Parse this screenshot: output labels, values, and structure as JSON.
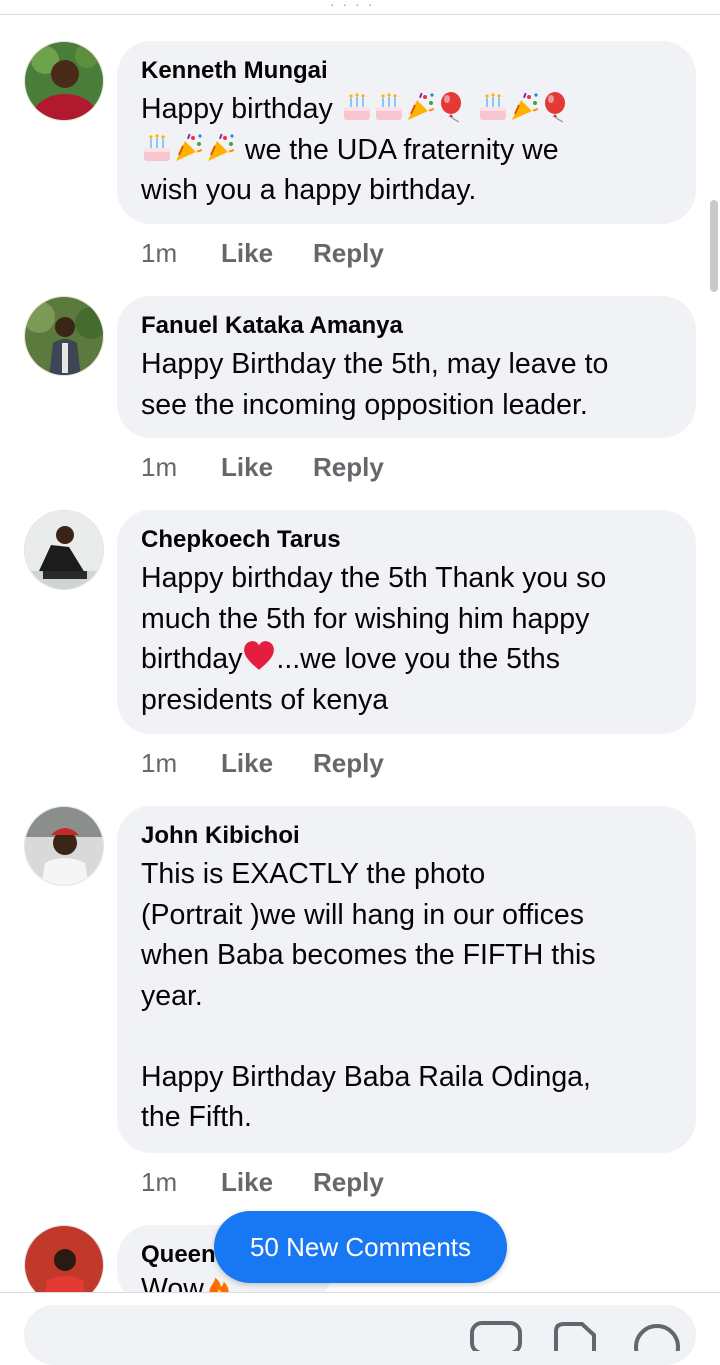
{
  "banner": {
    "new_comments": "50 New Comments"
  },
  "comments": [
    {
      "name": "Kenneth Mungai",
      "text_line1": "Happy birthday",
      "text_line2_suffix": " we the UDA fraternity we",
      "text_line3": "wish you a happy birthday.",
      "time": "1m",
      "like": "Like",
      "reply": "Reply"
    },
    {
      "name": "Fanuel Kataka Amanya",
      "text": "Happy Birthday the 5th, may leave to\nsee the incoming opposition leader.",
      "time": "1m",
      "like": "Like",
      "reply": "Reply"
    },
    {
      "name": "Chepkoech Tarus",
      "text_part1": "Happy birthday the 5th Thank you so\nmuch the 5th for wishing him happy\nbirthday",
      "text_part2": "...we love you the 5ths\npresidents of kenya",
      "time": "1m",
      "like": "Like",
      "reply": "Reply"
    },
    {
      "name": "John Kibichoi",
      "text": "This is EXACTLY the photo\n(Portrait )we will hang in our offices\nwhen Baba becomes the FIFTH this\nyear.\n\nHappy Birthday Baba Raila Odinga,\nthe Fifth.",
      "time": "1m",
      "like": "Like",
      "reply": "Reply"
    },
    {
      "name": "Queen",
      "text": "Wow"
    }
  ],
  "icons": {
    "cake": "birthday-cake-emoji",
    "party": "party-popper-emoji",
    "balloon": "balloon-emoji",
    "heart": "red-heart-emoji",
    "fire": "fire-emoji"
  },
  "colors": {
    "bubble": "#f0f2f5",
    "meta": "#65676b",
    "accent": "#1877f2"
  }
}
